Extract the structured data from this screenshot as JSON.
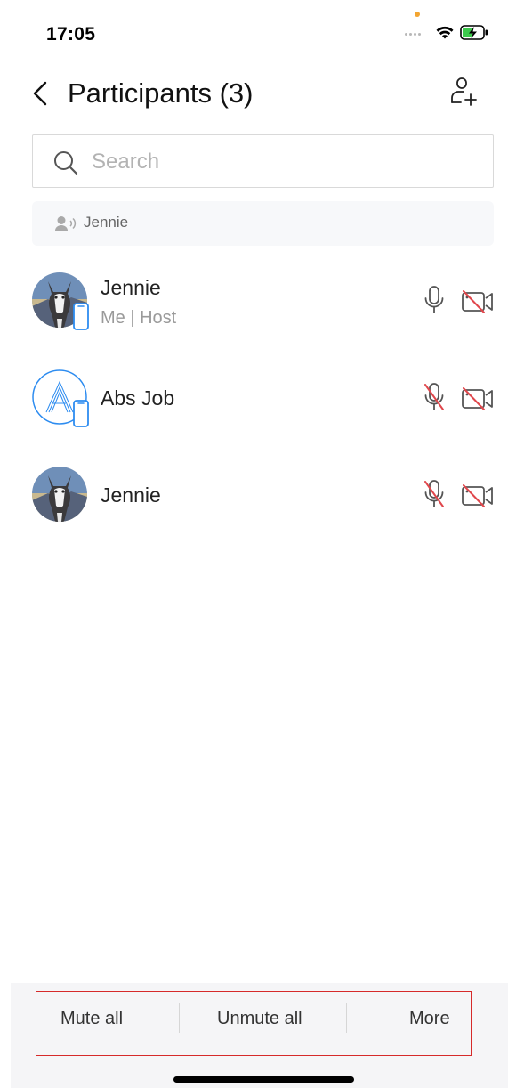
{
  "status_bar": {
    "time": "17:05",
    "icons": [
      "cellular-dots-icon",
      "wifi-icon",
      "battery-charging-icon"
    ],
    "privacy_dot_color": "#f3a531",
    "battery_color": "#3cc94c"
  },
  "header": {
    "title": "Participants (3)",
    "back_icon": "chevron-left-icon",
    "invite_icon": "add-user-icon"
  },
  "search": {
    "placeholder": "Search",
    "value": ""
  },
  "speaking": {
    "icon": "speaker-icon",
    "name": "Jennie"
  },
  "participants": [
    {
      "name": "Jennie",
      "subtitle": "Me | Host",
      "avatar": "husky-photo",
      "device": "mobile-icon",
      "mic": "mic-on-icon",
      "camera": "camera-off-icon"
    },
    {
      "name": "Abs Job",
      "subtitle": "",
      "avatar": "letter-a-avatar",
      "device": "mobile-icon",
      "mic": "mic-off-icon",
      "camera": "camera-off-icon"
    },
    {
      "name": "Jennie",
      "subtitle": "",
      "avatar": "husky-photo",
      "device": "",
      "mic": "mic-off-icon",
      "camera": "camera-off-icon"
    }
  ],
  "actions": {
    "mute_all": "Mute all",
    "unmute_all": "Unmute all",
    "more": "More"
  },
  "colors": {
    "accent_blue": "#2d8cf0",
    "muted_red": "#e0474c",
    "highlight_border": "#d62a2a"
  }
}
